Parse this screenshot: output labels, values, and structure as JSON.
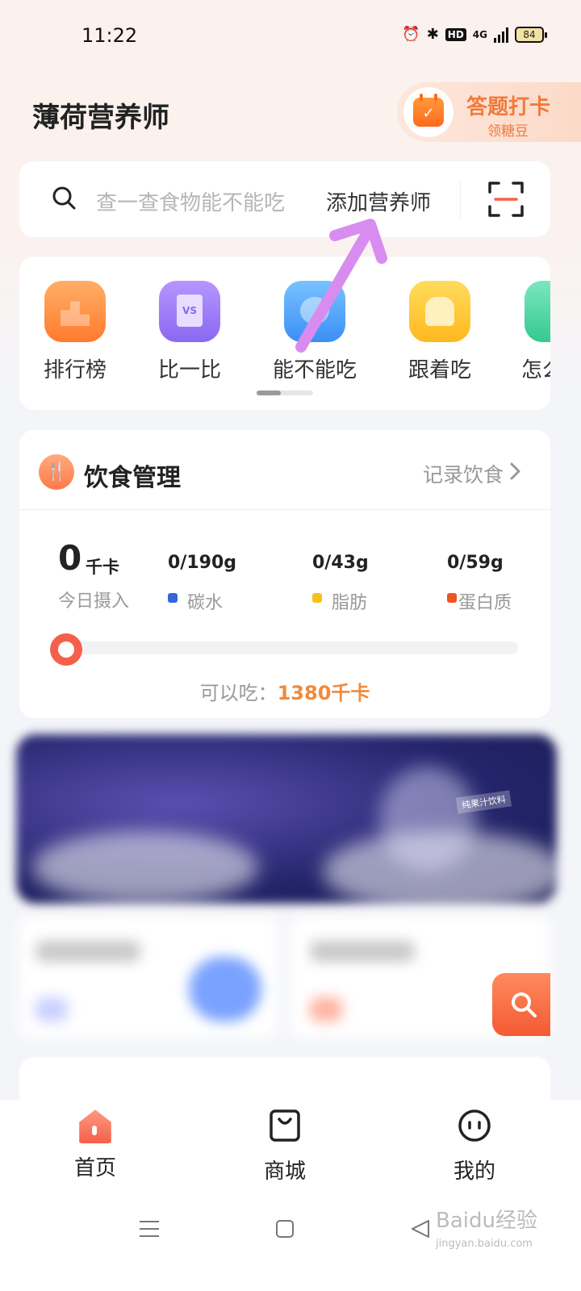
{
  "status_bar": {
    "time": "11:22",
    "network": "4G",
    "battery": "84"
  },
  "header": {
    "title": "薄荷营养师",
    "checkin": {
      "title": "答题打卡",
      "subtitle": "领糖豆"
    }
  },
  "search": {
    "placeholder": "查一查食物能不能吃",
    "add_nutritionist": "添加营养师"
  },
  "shortcuts": [
    {
      "label": "排行榜",
      "icon": "ranking-icon"
    },
    {
      "label": "比一比",
      "icon": "compare-icon"
    },
    {
      "label": "能不能吃",
      "icon": "can-eat-icon"
    },
    {
      "label": "跟着吃",
      "icon": "follow-eat-icon"
    },
    {
      "label": "怎么",
      "icon": "how-icon"
    }
  ],
  "diet": {
    "title": "饮食管理",
    "record_link": "记录饮食",
    "intake_value": "0",
    "intake_unit": "千卡",
    "intake_label": "今日摄入",
    "macros": [
      {
        "value": "0/190g",
        "label": "碳水",
        "color": "#3366dd"
      },
      {
        "value": "0/43g",
        "label": "脂肪",
        "color": "#f5c21a"
      },
      {
        "value": "0/59g",
        "label": "蛋白质",
        "color": "#ee5522"
      }
    ],
    "progress": 0,
    "can_eat_label": "可以吃：",
    "can_eat_value": "1380千卡"
  },
  "banner": {
    "tag": "纯果汁饮料"
  },
  "tabs": [
    {
      "label": "首页",
      "icon": "home-icon",
      "active": true
    },
    {
      "label": "商城",
      "icon": "shop-icon",
      "active": false
    },
    {
      "label": "我的",
      "icon": "profile-icon",
      "active": false
    }
  ],
  "watermark": {
    "text": "Baidu经验",
    "sub": "jingyan.baidu.com"
  },
  "colors": {
    "accent": "#f08a3c",
    "annotation_arrow": "#d98cf0"
  }
}
